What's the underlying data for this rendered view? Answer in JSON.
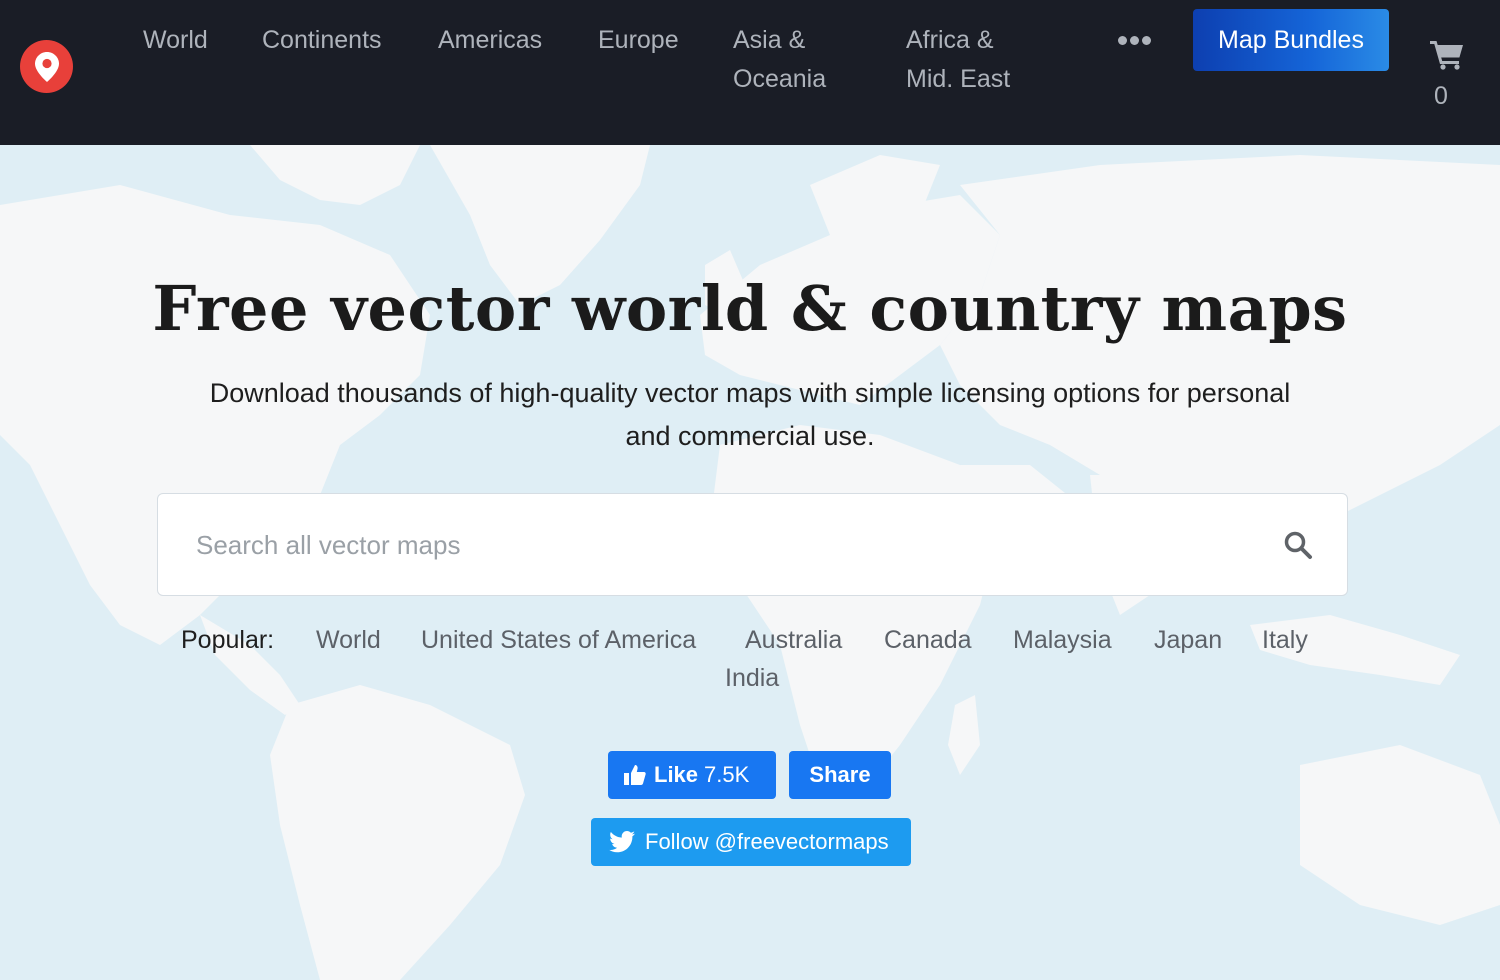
{
  "nav": {
    "items": [
      {
        "label": "World"
      },
      {
        "label": "Continents"
      },
      {
        "label": "Americas"
      },
      {
        "label": "Europe"
      },
      {
        "label": "Asia &"
      },
      {
        "label": "Oceania"
      },
      {
        "label": "Africa &"
      },
      {
        "label": "Mid. East"
      }
    ],
    "cta_label": "Map Bundles",
    "cart_count": "0"
  },
  "hero": {
    "title": "Free vector world & country maps",
    "subtitle_line1": "Download thousands of high-quality vector maps with simple licensing options for personal",
    "subtitle_line2": "and commercial use."
  },
  "search": {
    "placeholder": "Search all vector maps",
    "value": ""
  },
  "popular": {
    "label": "Popular:",
    "links": [
      "World",
      "United States of America",
      "Australia",
      "Canada",
      "Malaysia",
      "Japan",
      "Italy",
      "India"
    ]
  },
  "social": {
    "like_label": "Like",
    "like_count": "7.5K",
    "share_label": "Share",
    "follow_label": "Follow @freevectormaps"
  },
  "colors": {
    "navbar_bg": "#1a1d26",
    "logo_red": "#e8403a",
    "cta_blue": "#1565d8",
    "facebook_blue": "#1877f2",
    "twitter_blue": "#1d9bf0",
    "ocean": "#dfeef5",
    "land": "#f6f7f8"
  },
  "icons": [
    "map-pin-icon",
    "more-dots-icon",
    "cart-icon",
    "search-icon",
    "thumbs-up-icon",
    "twitter-bird-icon"
  ]
}
